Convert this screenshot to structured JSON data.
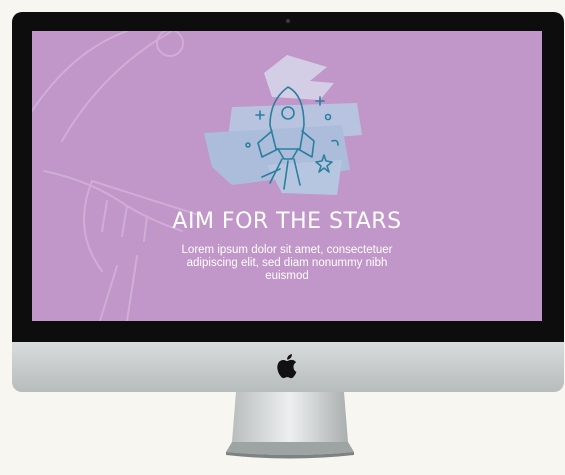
{
  "screen": {
    "title": "AIM FOR THE STARS",
    "body": "Lorem ipsum dolor sit amet, consectetuer adipiscing elit, sed diam nonummy nibh euismod",
    "background_color": "#c196c8",
    "illustration": "rocket-icon"
  },
  "device": {
    "logo": "apple-logo-icon",
    "bezel_color": "#0d0d0d",
    "chin_color": "#cfd3d3"
  }
}
